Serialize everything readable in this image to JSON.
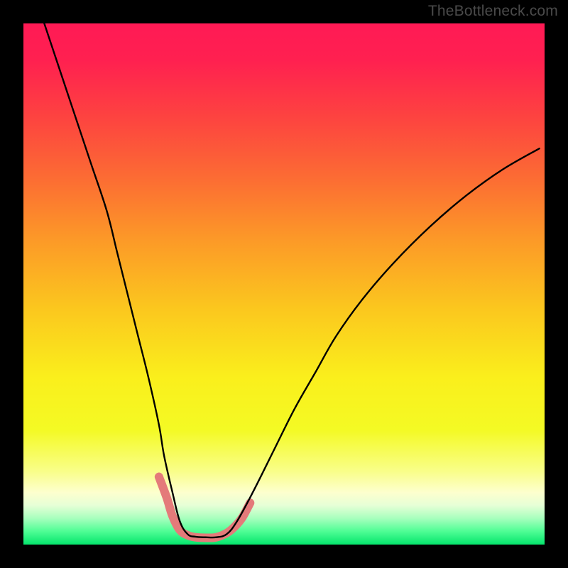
{
  "watermark": "TheBottleneck.com",
  "chart_data": {
    "type": "line",
    "title": "",
    "xlabel": "",
    "ylabel": "",
    "xlim": [
      0,
      100
    ],
    "ylim": [
      0,
      100
    ],
    "grid": false,
    "legend": false,
    "background_gradient": {
      "stops": [
        {
          "offset": 0.0,
          "color": "#ff1a55"
        },
        {
          "offset": 0.07,
          "color": "#ff2050"
        },
        {
          "offset": 0.18,
          "color": "#fd4340"
        },
        {
          "offset": 0.3,
          "color": "#fc6d33"
        },
        {
          "offset": 0.42,
          "color": "#fc9b27"
        },
        {
          "offset": 0.55,
          "color": "#fbc81e"
        },
        {
          "offset": 0.68,
          "color": "#faef1c"
        },
        {
          "offset": 0.78,
          "color": "#f4fa24"
        },
        {
          "offset": 0.86,
          "color": "#f9fe8a"
        },
        {
          "offset": 0.9,
          "color": "#fdffce"
        },
        {
          "offset": 0.925,
          "color": "#e6ffd6"
        },
        {
          "offset": 0.95,
          "color": "#a6ffbd"
        },
        {
          "offset": 0.975,
          "color": "#4dfd94"
        },
        {
          "offset": 1.0,
          "color": "#05e56c"
        }
      ]
    },
    "series": [
      {
        "name": "bottleneck-curve",
        "color": "#000000",
        "x": [
          4,
          7,
          10,
          13,
          16,
          18,
          20,
          22,
          24,
          26,
          27,
          28.6,
          30,
          31.5,
          33,
          35,
          37,
          39,
          41,
          44,
          48,
          52,
          56,
          60,
          65,
          71,
          78,
          85,
          92,
          99
        ],
        "y": [
          100,
          91,
          82,
          73,
          64,
          56,
          48,
          40,
          32,
          23,
          17,
          10,
          4.5,
          2.0,
          1.5,
          1.4,
          1.4,
          2.0,
          4.5,
          10,
          18,
          26,
          33,
          40,
          47,
          54,
          61,
          67,
          72,
          76
        ]
      }
    ],
    "markers": {
      "name": "highlight-band",
      "color": "#e47a7a",
      "stroke_width": 12,
      "x": [
        26.0,
        27.5,
        28.6,
        30.0,
        31.5,
        33.0,
        35.0,
        37.0,
        39.0,
        40.5,
        42.0,
        43.5
      ],
      "y": [
        13.0,
        9.0,
        5.5,
        2.8,
        1.8,
        1.4,
        1.3,
        1.4,
        2.2,
        3.4,
        5.2,
        8.0
      ]
    }
  }
}
